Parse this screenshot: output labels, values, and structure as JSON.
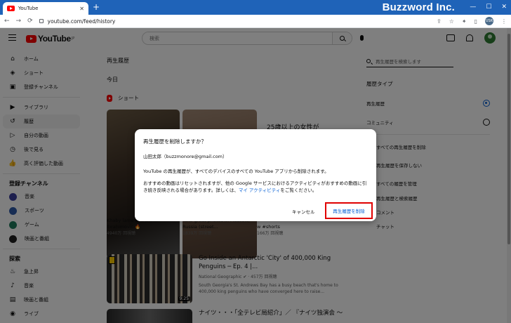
{
  "browser": {
    "tab_title": "YouTube",
    "tab_close": "✕",
    "new_tab": "+",
    "url": "youtube.com/feed/history",
    "brand": "Buzzword Inc.",
    "window_controls": [
      "—",
      "☐",
      "✕"
    ],
    "profile_initials": "USR"
  },
  "header": {
    "logo_text": "YouTube",
    "logo_sup": "JP",
    "search_placeholder": "検索"
  },
  "sidebar": {
    "items": [
      {
        "label": "ホーム",
        "icon": "home-icon",
        "glyph": "⌂"
      },
      {
        "label": "ショート",
        "icon": "shorts-icon",
        "glyph": "◈"
      },
      {
        "label": "登録チャンネル",
        "icon": "subscriptions-icon",
        "glyph": "▣"
      },
      {
        "label": "ライブラリ",
        "icon": "library-icon",
        "glyph": "▶"
      },
      {
        "label": "履歴",
        "icon": "history-icon",
        "glyph": "↺"
      },
      {
        "label": "自分の動画",
        "icon": "your-videos-icon",
        "glyph": "▷"
      },
      {
        "label": "後で見る",
        "icon": "watch-later-icon",
        "glyph": "◷"
      },
      {
        "label": "高く評価した動画",
        "icon": "like-icon",
        "glyph": "👍"
      }
    ],
    "subs_header": "登録チャンネル",
    "subs": [
      {
        "label": "音楽",
        "color": "#3a3f9c"
      },
      {
        "label": "スポーツ",
        "color": "#2f5aa8"
      },
      {
        "label": "ゲーム",
        "color": "#1f7a5c"
      },
      {
        "label": "映画と番組",
        "color": "#202020"
      }
    ],
    "explore_header": "探索",
    "explore": [
      {
        "label": "急上昇",
        "icon": "trending-icon",
        "glyph": "♨"
      },
      {
        "label": "音楽",
        "icon": "music-icon",
        "glyph": "♪"
      },
      {
        "label": "映画と番組",
        "icon": "movies-icon",
        "glyph": "▤"
      },
      {
        "label": "ライブ",
        "icon": "live-icon",
        "glyph": "◉"
      }
    ]
  },
  "main": {
    "page_title": "再生履歴",
    "today": "今日",
    "shorts_label": "ショート",
    "shorts": [
      {
        "title": "Khaby lame and Zlatan Ibrahimovic 🔥",
        "views": "4940万 回視聴"
      },
      {
        "title": "Take great photos in Moscow, Russia (street...",
        "views": "1839万 回視聴"
      },
      {
        "title": "w #shorts",
        "views": "166万 回視聴"
      }
    ],
    "short3_big": "25歳以上の女性が",
    "video": {
      "title": "Go Inside an Antarctic 'City' of 400,000 King Penguins ─ Ep. 4 |...",
      "channel": "National Geographic ✔ · 457万 回視聴",
      "desc": "South Georgia's St. Andrews Bay has a busy beach that's home to 400,000 king penguins who have converged here to raise...",
      "duration": "9:25"
    },
    "video2_title": "ナイツ・・・「全テレビ局紹介」／ 『ナイツ独演会 ～"
  },
  "right_panel": {
    "search_placeholder": "再生履歴を検索します",
    "type_header": "履歴タイプ",
    "options": [
      "再生履歴",
      "コミュニティ"
    ],
    "actions": [
      "すべての再生履歴を削除",
      "再生履歴を保存しない",
      "すべての履歴を管理",
      "再生履歴と検索履歴",
      "コメント",
      "チャット"
    ]
  },
  "dialog": {
    "title": "再生履歴を削除しますか？",
    "account": "山田太郎（buzzmonore@gmail.com）",
    "message1": "YouTube の再生履歴が、すべてのデバイスのすべての YouTube アプリから削除されます。",
    "message2": "おすすめの動画はリセットされますが、他の Google サービスにおけるアクティビティがおすすめの動画に引き続き反映される場合があります。詳しくは、",
    "message2_link": "マイ アクティビティ",
    "message2_end": "をご覧ください。",
    "cancel": "キャンセル",
    "confirm": "再生履歴を削除"
  }
}
